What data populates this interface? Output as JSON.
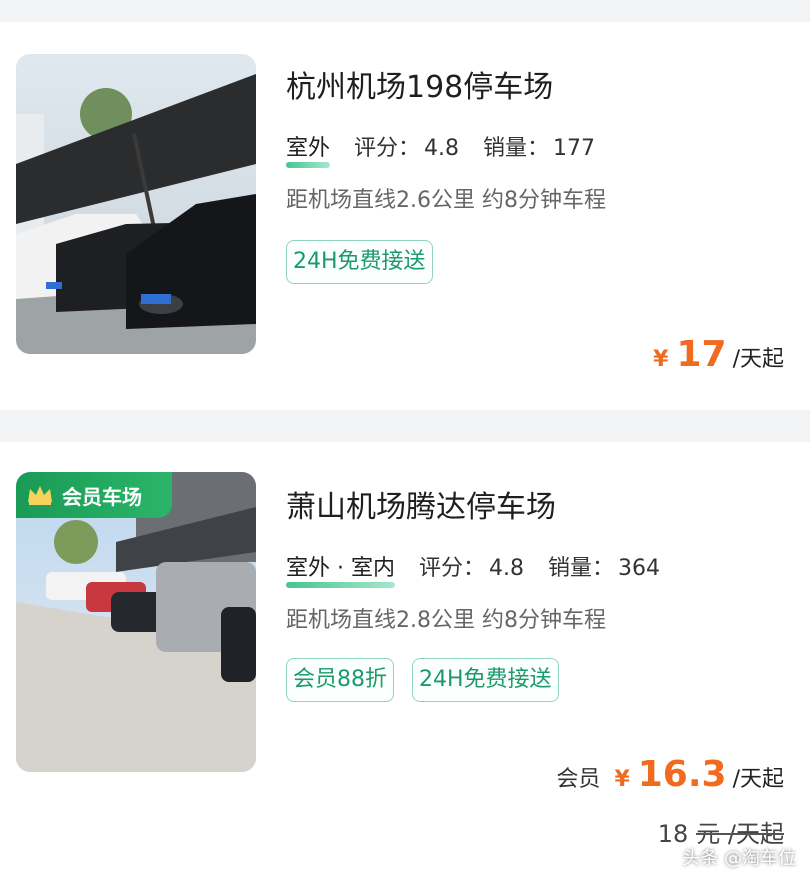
{
  "listings": [
    {
      "title": "杭州机场198停车场",
      "location": "室外",
      "rating_label": "评分：",
      "rating": "4.8",
      "sales_label": "销量：",
      "sales": "177",
      "distance": "距机场直线2.6公里 约8分钟车程",
      "tags": [
        "24H免费接送"
      ],
      "currency": "¥",
      "price": "17",
      "unit": "/天起"
    },
    {
      "badge": "会员车场",
      "title": "萧山机场腾达停车场",
      "location": "室外 · 室内",
      "rating_label": "评分：",
      "rating": "4.8",
      "sales_label": "销量：",
      "sales": "364",
      "distance": "距机场直线2.8公里 约8分钟车程",
      "tags": [
        "会员88折",
        "24H免费接送"
      ],
      "member_label": "会员",
      "currency": "¥",
      "price": "16.3",
      "unit": "/天起",
      "original_price": "18",
      "original_unit": "元 /天起"
    }
  ],
  "watermark": "头条 @淘车位",
  "colors": {
    "accent": "#f06a1f",
    "tag_green": "#1d9a6c",
    "badge_green": "#1a9a55"
  }
}
